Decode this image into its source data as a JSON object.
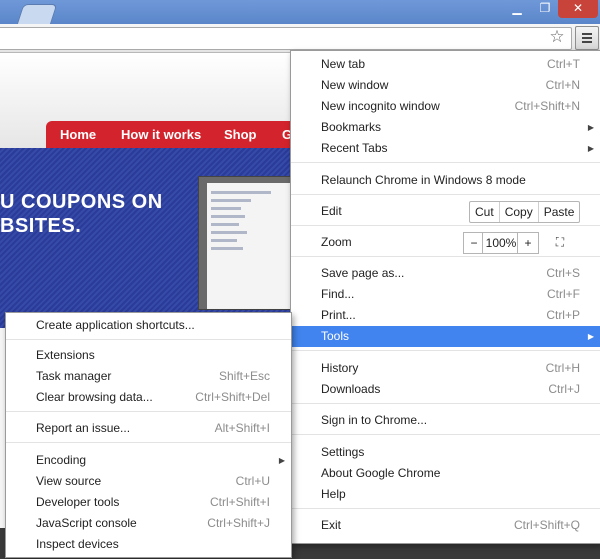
{
  "window": {
    "minimize": "▁",
    "maximize": "❐",
    "close": "✕"
  },
  "icons": {
    "star": "☆",
    "submenu_arrow": "▶"
  },
  "page": {
    "nav": [
      "Home",
      "How it works",
      "Shop",
      "G"
    ],
    "banner_line1": "U COUPONS ON",
    "banner_line2": "BSITES."
  },
  "chrome_menu": {
    "new_tab": {
      "label": "New tab",
      "shortcut": "Ctrl+T"
    },
    "new_window": {
      "label": "New window",
      "shortcut": "Ctrl+N"
    },
    "new_incognito": {
      "label": "New incognito window",
      "shortcut": "Ctrl+Shift+N"
    },
    "bookmarks": {
      "label": "Bookmarks"
    },
    "recent_tabs": {
      "label": "Recent Tabs"
    },
    "relaunch": {
      "label": "Relaunch Chrome in Windows 8 mode"
    },
    "edit": {
      "label": "Edit",
      "cut": "Cut",
      "copy": "Copy",
      "paste": "Paste"
    },
    "zoom": {
      "label": "Zoom",
      "minus": "−",
      "value": "100%",
      "plus": "+",
      "fullscreen": "⛶"
    },
    "save_page": {
      "label": "Save page as...",
      "shortcut": "Ctrl+S"
    },
    "find": {
      "label": "Find...",
      "shortcut": "Ctrl+F"
    },
    "print": {
      "label": "Print...",
      "shortcut": "Ctrl+P"
    },
    "tools": {
      "label": "Tools"
    },
    "history": {
      "label": "History",
      "shortcut": "Ctrl+H"
    },
    "downloads": {
      "label": "Downloads",
      "shortcut": "Ctrl+J"
    },
    "sign_in": {
      "label": "Sign in to Chrome..."
    },
    "settings": {
      "label": "Settings"
    },
    "about": {
      "label": "About Google Chrome"
    },
    "help": {
      "label": "Help"
    },
    "exit": {
      "label": "Exit",
      "shortcut": "Ctrl+Shift+Q"
    }
  },
  "tools_menu": {
    "create_shortcuts": {
      "label": "Create application shortcuts..."
    },
    "extensions": {
      "label": "Extensions"
    },
    "task_manager": {
      "label": "Task manager",
      "shortcut": "Shift+Esc"
    },
    "clear_data": {
      "label": "Clear browsing data...",
      "shortcut": "Ctrl+Shift+Del"
    },
    "report_issue": {
      "label": "Report an issue...",
      "shortcut": "Alt+Shift+I"
    },
    "encoding": {
      "label": "Encoding"
    },
    "view_source": {
      "label": "View source",
      "shortcut": "Ctrl+U"
    },
    "developer_tools": {
      "label": "Developer tools",
      "shortcut": "Ctrl+Shift+I"
    },
    "js_console": {
      "label": "JavaScript console",
      "shortcut": "Ctrl+Shift+J"
    },
    "inspect_devices": {
      "label": "Inspect devices"
    }
  },
  "colors": {
    "highlight": "#4284ef",
    "nav_red": "#d3232c",
    "banner_blue": "#2a3b98",
    "titlebar": "#5a86c9"
  }
}
